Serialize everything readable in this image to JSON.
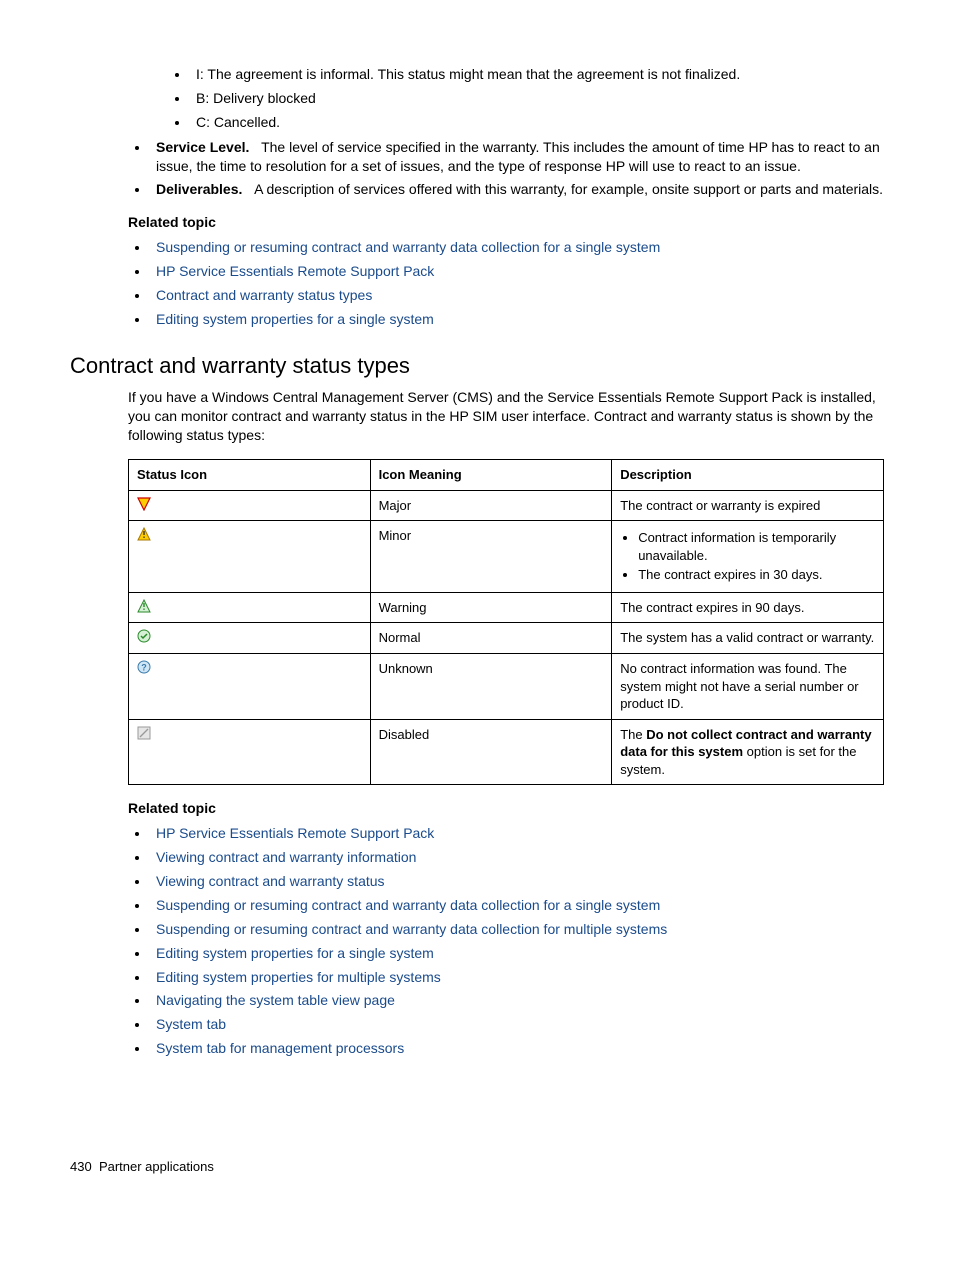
{
  "top_list": {
    "sub_items": [
      "I: The agreement is informal. This status might mean that the agreement is not finalized.",
      "B: Delivery blocked",
      "C: Cancelled."
    ],
    "service_level_label": "Service Level.",
    "service_level_text": "The level of service specified in the warranty. This includes the amount of time HP has to react to an issue, the time to resolution for a set of issues, and the type of response HP will use to react to an issue.",
    "deliverables_label": "Deliverables.",
    "deliverables_text": "A description of services offered with this warranty, for example, onsite support or parts and materials."
  },
  "related1_heading": "Related topic",
  "related1": [
    "Suspending or resuming contract and warranty data collection for a single system",
    "HP Service Essentials Remote Support Pack",
    "Contract and warranty status types",
    "Editing system properties for a single system"
  ],
  "section_heading": "Contract and warranty status types",
  "section_intro": "If you have a Windows Central Management Server (CMS) and the Service Essentials Remote Support Pack is installed, you can monitor contract and warranty status in the HP SIM user interface. Contract and warranty status is shown by the following status types:",
  "table": {
    "headers": [
      "Status Icon",
      "Icon Meaning",
      "Description"
    ],
    "rows": [
      {
        "meaning": "Major",
        "desc_type": "text",
        "desc": "The contract or warranty is expired"
      },
      {
        "meaning": "Minor",
        "desc_type": "list",
        "desc_items": [
          "Contract information is temporarily unavailable.",
          "The contract expires in 30 days."
        ]
      },
      {
        "meaning": "Warning",
        "desc_type": "text",
        "desc": "The contract expires in 90 days."
      },
      {
        "meaning": "Normal",
        "desc_type": "text",
        "desc": "The system has a valid contract or warranty."
      },
      {
        "meaning": "Unknown",
        "desc_type": "text",
        "desc": "No contract information was found. The system might not have a serial number or product ID."
      },
      {
        "meaning": "Disabled",
        "desc_type": "rich",
        "pre": "The ",
        "bold": "Do not collect contract and warranty data for this system",
        "post": " option is set for the system."
      }
    ]
  },
  "related2_heading": "Related topic",
  "related2": [
    "HP Service Essentials Remote Support Pack",
    "Viewing contract and warranty information",
    "Viewing contract and warranty status",
    "Suspending or resuming contract and warranty data collection for a single system",
    "Suspending or resuming contract and warranty data collection for multiple systems",
    "Editing system properties for a single system",
    "Editing system properties for multiple systems",
    "Navigating the system table view page",
    "System tab",
    "System tab for management processors"
  ],
  "footer": {
    "page": "430",
    "title": "Partner applications"
  }
}
